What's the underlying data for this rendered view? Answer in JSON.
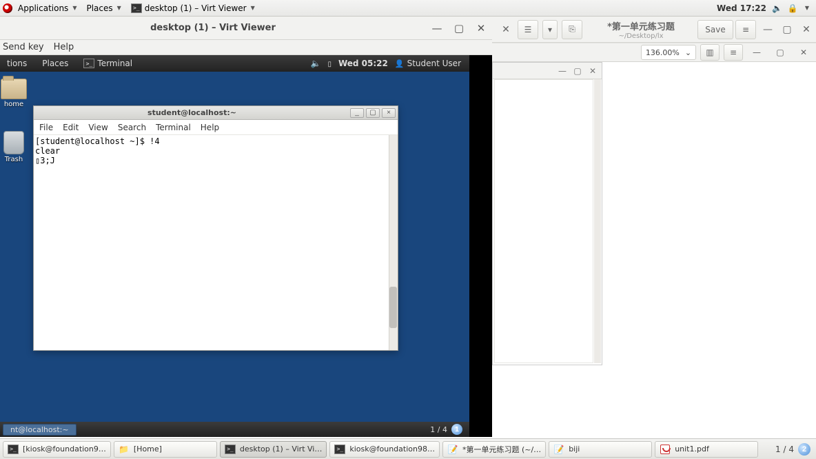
{
  "host_panel": {
    "applications": "Applications",
    "places": "Places",
    "running_app": "desktop (1) – Virt Viewer",
    "clock": "Wed 17:22"
  },
  "virt_viewer": {
    "title": "desktop (1) – Virt Viewer",
    "menu": {
      "send_key": "Send key",
      "help": "Help"
    },
    "win": {
      "min": "—",
      "max": "▢",
      "close": "✕"
    }
  },
  "inner_panel": {
    "items": [
      "tions",
      "Places",
      "Terminal"
    ],
    "clock": "Wed 05:22",
    "user": "Student User"
  },
  "inner_icons": {
    "home": "home",
    "trash": "Trash"
  },
  "terminal": {
    "title": "student@localhost:~",
    "menu": [
      "File",
      "Edit",
      "View",
      "Search",
      "Terminal",
      "Help"
    ],
    "content": "[student@localhost ~]$ !4\nclear\n▯3;J",
    "win": {
      "min": "_",
      "max": "▢",
      "close": "×"
    }
  },
  "inner_taskbar": {
    "item": "nt@localhost:~",
    "workspace_label": "1 / 4",
    "workspace_num": "1"
  },
  "doc_window": {
    "title": "*第一单元练习题",
    "subtitle": "~/Desktop/lx",
    "save": "Save",
    "btn": {
      "open": "☰",
      "back": "▾",
      "bkmk": "⎘",
      "menu": "≡",
      "min": "—",
      "max": "▢",
      "close": "✕"
    }
  },
  "pdf_bar": {
    "zoom": "136.00%",
    "btn": {
      "thumb": "▥",
      "menu": "≡",
      "min": "—",
      "max": "▢",
      "close": "✕",
      "chev": "⌄"
    }
  },
  "side_win": {
    "min": "—",
    "max": "▢",
    "close": "✕"
  },
  "host_task": {
    "items": [
      {
        "label": "[kiosk@foundation9…",
        "icon": "term"
      },
      {
        "label": "[Home]",
        "icon": "fold"
      },
      {
        "label": "desktop (1) – Virt Vi…",
        "icon": "term",
        "active": true
      },
      {
        "label": "kiosk@foundation98…",
        "icon": "term"
      },
      {
        "label": "*第一单元练习题 (~/…",
        "icon": "note"
      },
      {
        "label": "biji",
        "icon": "note"
      },
      {
        "label": "unit1.pdf",
        "icon": "pdf"
      }
    ],
    "workspace_label": "1 / 4",
    "workspace_num": "2"
  }
}
